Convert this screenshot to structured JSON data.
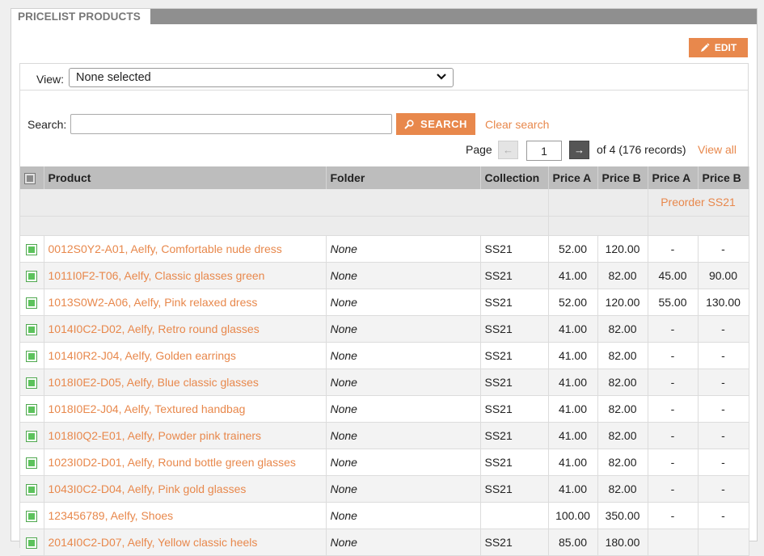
{
  "panel": {
    "title": "PRICELIST PRODUCTS",
    "edit_label": "EDIT"
  },
  "view": {
    "label": "View:",
    "selected": "None selected"
  },
  "search": {
    "label": "Search:",
    "value": "",
    "placeholder": "",
    "button_label": "SEARCH",
    "clear_label": "Clear search"
  },
  "pagination": {
    "page_label": "Page",
    "prev_symbol": "←",
    "next_symbol": "→",
    "current_page": "1",
    "of_text": "of 4 (176 records)",
    "view_all_label": "View all"
  },
  "table": {
    "headers": [
      "Product",
      "Folder",
      "Collection",
      "Price A",
      "Price B",
      "Price A",
      "Price B"
    ],
    "group_label": "Preorder SS21",
    "rows": [
      {
        "product": "0012S0Y2-A01, Aelfy, Comfortable nude dress",
        "folder": "None",
        "collection": "SS21",
        "pa": "52.00",
        "pb": "120.00",
        "ppa": "-",
        "ppb": "-"
      },
      {
        "product": "1011I0F2-T06, Aelfy, Classic glasses green",
        "folder": "None",
        "collection": "SS21",
        "pa": "41.00",
        "pb": "82.00",
        "ppa": "45.00",
        "ppb": "90.00"
      },
      {
        "product": "1013S0W2-A06, Aelfy, Pink relaxed dress",
        "folder": "None",
        "collection": "SS21",
        "pa": "52.00",
        "pb": "120.00",
        "ppa": "55.00",
        "ppb": "130.00"
      },
      {
        "product": "1014I0C2-D02, Aelfy, Retro round glasses",
        "folder": "None",
        "collection": "SS21",
        "pa": "41.00",
        "pb": "82.00",
        "ppa": "-",
        "ppb": "-"
      },
      {
        "product": "1014I0R2-J04, Aelfy, Golden earrings",
        "folder": "None",
        "collection": "SS21",
        "pa": "41.00",
        "pb": "82.00",
        "ppa": "-",
        "ppb": "-"
      },
      {
        "product": "1018I0E2-D05, Aelfy, Blue classic glasses",
        "folder": "None",
        "collection": "SS21",
        "pa": "41.00",
        "pb": "82.00",
        "ppa": "-",
        "ppb": "-"
      },
      {
        "product": "1018I0E2-J04, Aelfy, Textured handbag",
        "folder": "None",
        "collection": "SS21",
        "pa": "41.00",
        "pb": "82.00",
        "ppa": "-",
        "ppb": "-"
      },
      {
        "product": "1018I0Q2-E01, Aelfy, Powder pink trainers",
        "folder": "None",
        "collection": "SS21",
        "pa": "41.00",
        "pb": "82.00",
        "ppa": "-",
        "ppb": "-"
      },
      {
        "product": "1023I0D2-D01, Aelfy, Round bottle green glasses",
        "folder": "None",
        "collection": "SS21",
        "pa": "41.00",
        "pb": "82.00",
        "ppa": "-",
        "ppb": "-"
      },
      {
        "product": "1043I0C2-D04, Aelfy, Pink gold glasses",
        "folder": "None",
        "collection": "SS21",
        "pa": "41.00",
        "pb": "82.00",
        "ppa": "-",
        "ppb": "-"
      },
      {
        "product": "123456789, Aelfy, Shoes",
        "folder": "None",
        "collection": "",
        "pa": "100.00",
        "pb": "350.00",
        "ppa": "-",
        "ppb": "-"
      },
      {
        "product": "2014I0C2-D07, Aelfy, Yellow classic heels",
        "folder": "None",
        "collection": "SS21",
        "pa": "85.00",
        "pb": "180.00",
        "ppa": "",
        "ppb": ""
      }
    ]
  },
  "colors": {
    "accent": "#e8884c",
    "header_bar": "#8f8f8f",
    "table_header": "#bdbdbd",
    "checkbox_green": "#5cc25c"
  }
}
